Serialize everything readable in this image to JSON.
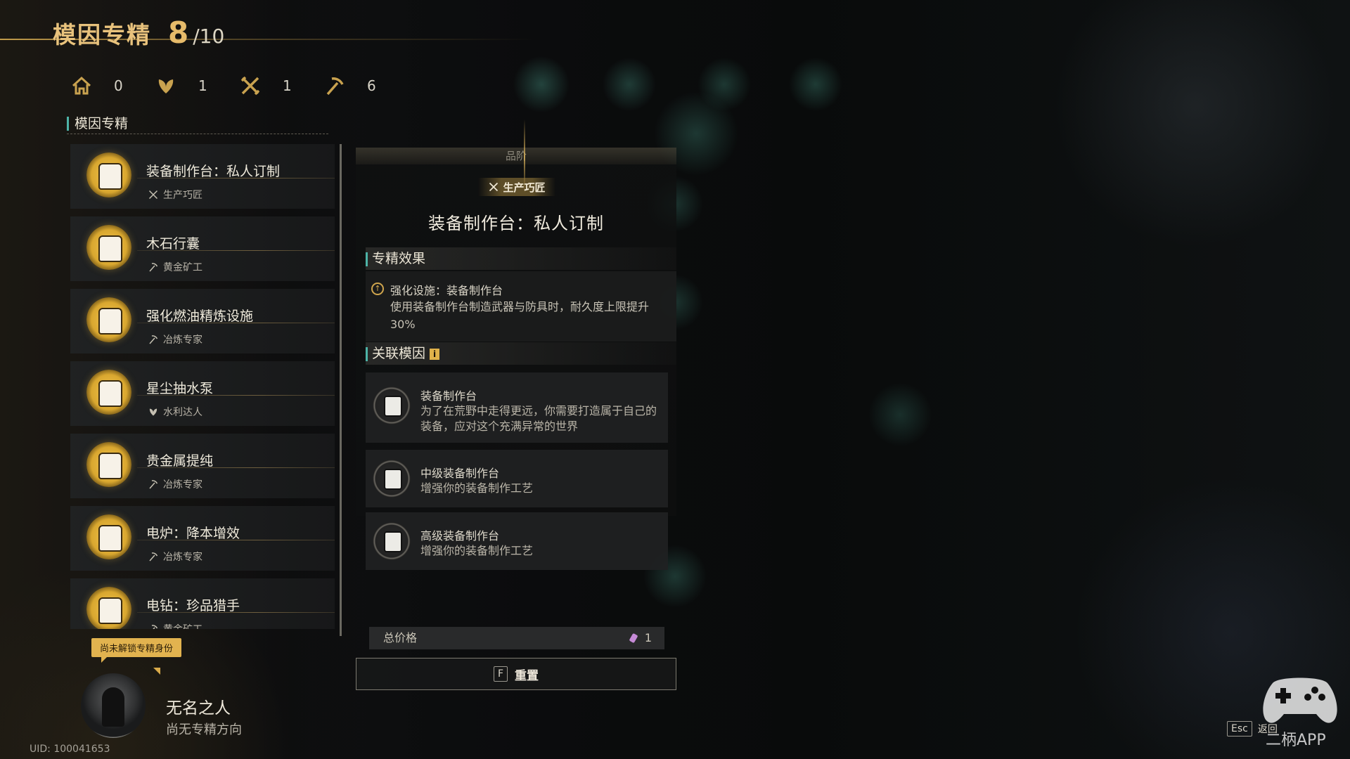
{
  "header": {
    "title": "模因专精",
    "current": "8",
    "total": "/10"
  },
  "stats": [
    {
      "icon": "home-icon",
      "value": "0"
    },
    {
      "icon": "leaf-icon",
      "value": "1"
    },
    {
      "icon": "tools-icon",
      "value": "1"
    },
    {
      "icon": "pickaxe-icon",
      "value": "6"
    }
  ],
  "sidebar": {
    "section_label": "模因专精",
    "items": [
      {
        "name": "装备制作台：私人订制",
        "category": "生产巧匠",
        "category_icon": "tools-icon"
      },
      {
        "name": "木石行囊",
        "category": "黄金矿工",
        "category_icon": "pickaxe-icon"
      },
      {
        "name": "强化燃油精炼设施",
        "category": "冶炼专家",
        "category_icon": "pickaxe-icon"
      },
      {
        "name": "星尘抽水泵",
        "category": "水利达人",
        "category_icon": "leaf-icon"
      },
      {
        "name": "贵金属提纯",
        "category": "冶炼专家",
        "category_icon": "pickaxe-icon"
      },
      {
        "name": "电炉：降本增效",
        "category": "冶炼专家",
        "category_icon": "pickaxe-icon"
      },
      {
        "name": "电钻：珍品猎手",
        "category": "黄金矿工",
        "category_icon": "pickaxe-icon"
      }
    ]
  },
  "profile": {
    "tooltip": "尚未解锁专精身份",
    "name": "无名之人",
    "direction": "尚无专精方向",
    "uid": "UID: 100041653"
  },
  "detail": {
    "quality_label": "品阶",
    "tag": "生产巧匠",
    "title": "装备制作台：私人订制",
    "effect_header": "专精效果",
    "effect_title": "强化设施：装备制作台",
    "effect_desc": "使用装备制作台制造武器与防具时，耐久度上限提升30%",
    "related_header": "关联模因",
    "related": [
      {
        "title": "装备制作台",
        "desc": "为了在荒野中走得更远，你需要打造属于自己的装备，应对这个充满异常的世界"
      },
      {
        "title": "中级装备制作台",
        "desc": "增强你的装备制作工艺"
      },
      {
        "title": "高级装备制作台",
        "desc": "增强你的装备制作工艺"
      }
    ],
    "price_label": "总价格",
    "price_value": "1",
    "reset_key": "F",
    "reset_label": "重置"
  },
  "footer": {
    "esc_key": "Esc",
    "back_label": "返回"
  },
  "watermark": {
    "text": "二柄APP"
  },
  "colors": {
    "gold": "#e6bb6a",
    "teal_accent": "#4db3a7",
    "tooltip_bg": "#e2b34f"
  }
}
